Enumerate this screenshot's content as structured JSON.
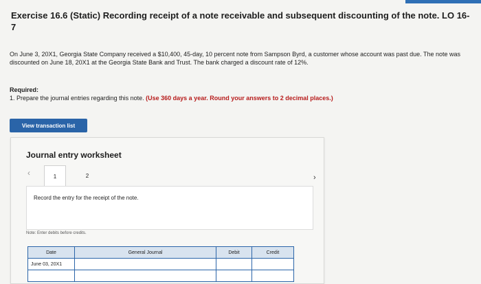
{
  "exercise": {
    "title": "Exercise 16.6 (Static) Recording receipt of a note receivable and subsequent discounting of the note. LO 16-7",
    "problem_text": "On June 3, 20X1, Georgia State Company received a $10,400, 45-day, 10 percent note from Sampson Byrd, a customer whose account was past due. The note was discounted on June 18, 20X1 at the Georgia State Bank and Trust. The bank charged a discount rate of 12%.",
    "required_label": "Required:",
    "required_prefix": "1. Prepare the journal entries regarding this note.",
    "required_emphasis": "(Use 360 days a year. Round your answers to 2 decimal places.)"
  },
  "actions": {
    "view_transaction_list": "View transaction list"
  },
  "worksheet": {
    "title": "Journal entry worksheet",
    "tabs": [
      "1",
      "2"
    ],
    "instruction": "Record the entry for the receipt of the note.",
    "note": "Note: Enter debits before credits.",
    "columns": {
      "date": "Date",
      "journal": "General Journal",
      "debit": "Debit",
      "credit": "Credit"
    },
    "rows": [
      {
        "date": "June 03, 20X1",
        "journal": "",
        "debit": "",
        "credit": ""
      },
      {
        "date": "",
        "journal": "",
        "debit": "",
        "credit": ""
      }
    ]
  }
}
